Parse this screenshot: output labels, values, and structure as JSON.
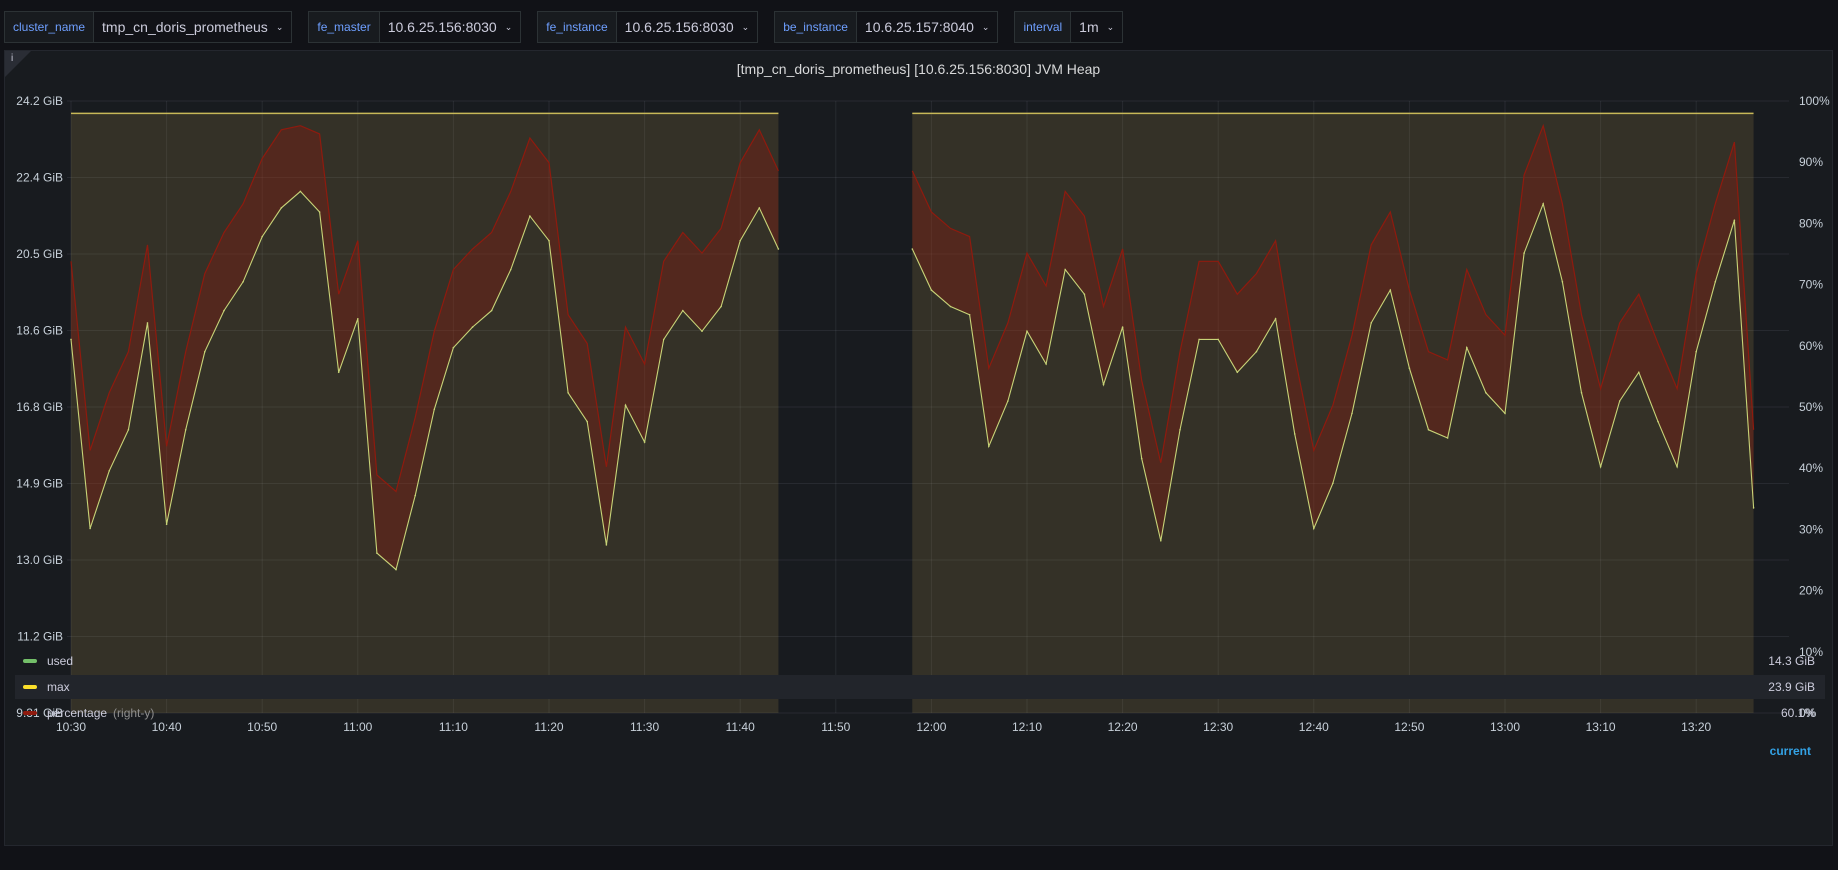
{
  "variables": [
    {
      "label": "cluster_name",
      "value": "tmp_cn_doris_prometheus"
    },
    {
      "label": "fe_master",
      "value": "10.6.25.156:8030"
    },
    {
      "label": "fe_instance",
      "value": "10.6.25.156:8030"
    },
    {
      "label": "be_instance",
      "value": "10.6.25.157:8040"
    },
    {
      "label": "interval",
      "value": "1m"
    }
  ],
  "panel": {
    "title": "[tmp_cn_doris_prometheus] [10.6.25.156:8030] JVM Heap",
    "info_icon": "info-icon"
  },
  "legend": {
    "header": "current",
    "items": [
      {
        "name": "used",
        "value": "14.3 GiB",
        "color": "#73bf69",
        "note": ""
      },
      {
        "name": "max",
        "value": "23.9 GiB",
        "color": "#fade2a",
        "note": ""
      },
      {
        "name": "percentage",
        "value": "60.1%",
        "color": "#8f1a0e",
        "note": "(right-y)"
      }
    ]
  },
  "chart_data": {
    "type": "line",
    "title": "[tmp_cn_doris_prometheus] [10.6.25.156:8030] JVM Heap",
    "x_ticks": [
      "10:30",
      "10:40",
      "10:50",
      "11:00",
      "11:10",
      "11:20",
      "11:30",
      "11:40",
      "11:50",
      "12:00",
      "12:10",
      "12:20",
      "12:30",
      "12:40",
      "12:50",
      "13:00",
      "13:10",
      "13:20"
    ],
    "y_left_ticks": [
      "9.31 GiB",
      "11.2 GiB",
      "13.0 GiB",
      "14.9 GiB",
      "16.8 GiB",
      "18.6 GiB",
      "20.5 GiB",
      "22.4 GiB",
      "24.2 GiB"
    ],
    "y_right_ticks": [
      "0%",
      "10%",
      "20%",
      "30%",
      "40%",
      "50%",
      "60%",
      "70%",
      "80%",
      "90%",
      "100%"
    ],
    "y_left_range_gib": [
      9.31,
      24.2
    ],
    "y_right_range_pct": [
      0,
      100
    ],
    "gap": [
      "11:44",
      "11:57"
    ],
    "series": [
      {
        "name": "used",
        "axis": "left",
        "color": "#c8d478",
        "x_minutes_from_1030": [
          0,
          2,
          4,
          6,
          8,
          10,
          12,
          14,
          16,
          18,
          20,
          22,
          24,
          26,
          28,
          30,
          32,
          34,
          36,
          38,
          40,
          42,
          44,
          46,
          48,
          50,
          52,
          54,
          56,
          58,
          60,
          62,
          64,
          66,
          68,
          70,
          72,
          74,
          76,
          78,
          80,
          82,
          84,
          86,
          88,
          90,
          92,
          94,
          96,
          98,
          100,
          102,
          104,
          106,
          108,
          110,
          112,
          114,
          116,
          118,
          120,
          122,
          124,
          126,
          128,
          130,
          132,
          134,
          136,
          138,
          140,
          142,
          144,
          146,
          148,
          150,
          152,
          154,
          156,
          158,
          160,
          162,
          164,
          166,
          168,
          170,
          172,
          174,
          176
        ],
        "values_gib": [
          18.4,
          13.8,
          15.2,
          16.2,
          18.8,
          13.9,
          16.2,
          18.1,
          19.1,
          19.8,
          20.9,
          21.6,
          22.0,
          21.5,
          17.6,
          18.9,
          13.2,
          12.8,
          14.6,
          16.7,
          18.2,
          18.7,
          19.1,
          20.1,
          21.4,
          20.8,
          17.1,
          16.4,
          13.4,
          16.8,
          15.9,
          18.4,
          19.1,
          18.6,
          19.2,
          20.8,
          21.6,
          20.6,
          17.4,
          15.0,
          14.3,
          16.9,
          18.2,
          19.4,
          20.6,
          19.6,
          19.2,
          19.0,
          15.8,
          16.9,
          18.6,
          17.8,
          20.1,
          19.5,
          17.3,
          18.7,
          15.5,
          13.5,
          16.2,
          18.4,
          18.4,
          17.6,
          18.1,
          18.9,
          16.1,
          13.8,
          14.9,
          16.6,
          18.8,
          19.6,
          17.7,
          16.2,
          16.0,
          18.2,
          17.1,
          16.6,
          20.5,
          21.7,
          19.8,
          17.1,
          15.3,
          16.9,
          17.6,
          16.4,
          15.3,
          18.1,
          19.8,
          21.3,
          14.3
        ],
        "values_note": "Values are approximate readings; points after 11:44 and before 11:57 are null."
      },
      {
        "name": "max",
        "axis": "left",
        "color": "#c8b858",
        "constant_gib": 23.9
      },
      {
        "name": "percentage",
        "axis": "right",
        "color": "#8f1a0e"
      }
    ]
  }
}
